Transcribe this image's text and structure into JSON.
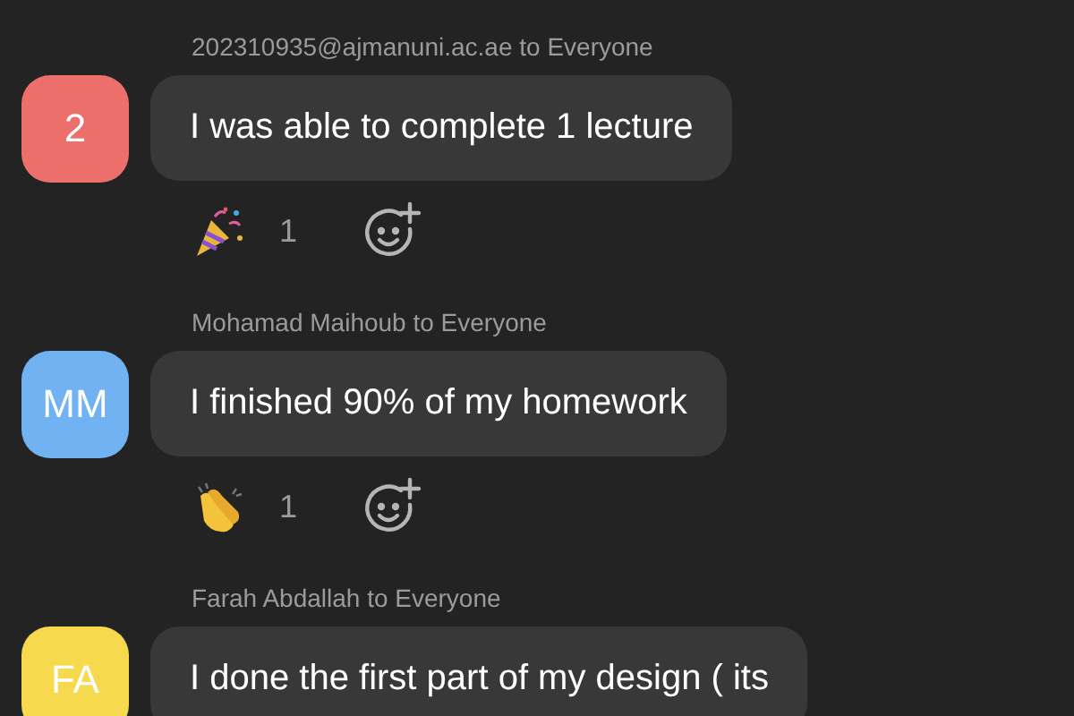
{
  "messages": [
    {
      "sender": "202310935@ajmanuni.ac.ae to Everyone",
      "initials": "2",
      "color": "#ec6f6c",
      "text": "I was able to complete 1 lecture",
      "reactions": [
        {
          "kind": "party",
          "count": "1"
        }
      ]
    },
    {
      "sender": "Mohamad Maihoub to Everyone",
      "initials": "MM",
      "color": "#71b3f2",
      "text": "I finished 90% of my homework",
      "reactions": [
        {
          "kind": "clap",
          "count": "1"
        }
      ]
    },
    {
      "sender": "Farah Abdallah to Everyone",
      "initials": "FA",
      "color": "#f6d94c",
      "text": "I done the first part of my design ( its"
    }
  ]
}
